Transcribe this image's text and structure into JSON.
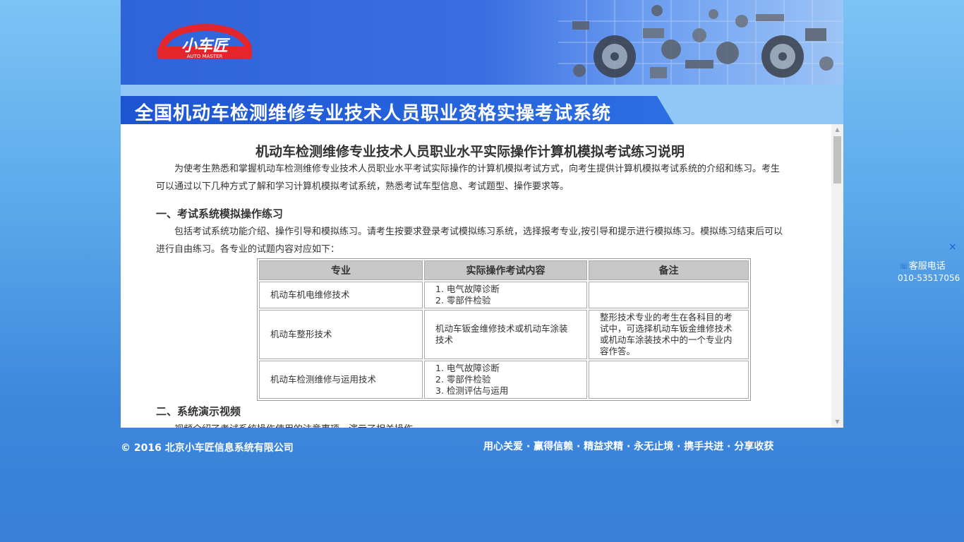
{
  "logo": {
    "brand": "小车匠",
    "sub": "AUTO MASTER"
  },
  "system_title": "全国机动车检测维修专业技术人员职业资格实操考试系统",
  "doc": {
    "title": "机动车检测维修专业技术人员职业水平实际操作计算机模拟考试练习说明",
    "intro": "为使考生熟悉和掌握机动车检测维修专业技术人员职业水平考试实际操作的计算机模拟考试方式，向考生提供计算机模拟考试系统的介绍和练习。考生可以通过以下几种方式了解和学习计算机模拟考试系统，熟悉考试车型信息、考试题型、操作要求等。",
    "section1_title": "一、考试系统模拟操作练习",
    "section1_text": "包括考试系统功能介绍、操作引导和模拟练习。请考生按要求登录考试模拟练习系统，选择报考专业,按引导和提示进行模拟练习。模拟练习结束后可以进行自由练习。各专业的试题内容对应如下：",
    "table": {
      "headers": [
        "专业",
        "实际操作考试内容",
        "备注"
      ],
      "rows": [
        {
          "major": "机动车机电维修技术",
          "content": [
            "1. 电气故障诊断",
            "2. 零部件检验"
          ],
          "note": ""
        },
        {
          "major": "机动车整形技术",
          "content": [
            "机动车钣金维修技术或机动车涂装技术"
          ],
          "note": "整形技术专业的考生在各科目的考试中，可选择机动车钣金维修技术或机动车涂装技术中的一个专业内容作答。"
        },
        {
          "major": "机动车检测维修与运用技术",
          "content": [
            "1. 电气故障诊断",
            "2. 零部件检验",
            "3. 检测评估与运用"
          ],
          "note": ""
        }
      ]
    },
    "section2_title": "二、系统演示视频",
    "section2_text": "视频介绍了考试系统操作使用的注意事项，演示了相关操作。"
  },
  "footer": {
    "copyright": "© 2016 北京小车匠信息系统有限公司",
    "slogan": "用心关爱 · 赢得信赖 · 精益求精 · 永无止境 · 携手共进 · 分享收获"
  },
  "service": {
    "close": "×",
    "label": "客服电话",
    "phone": "010-53517056"
  }
}
